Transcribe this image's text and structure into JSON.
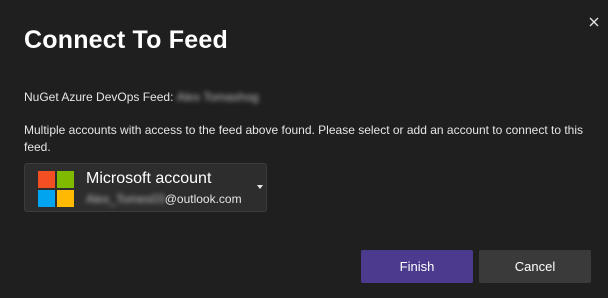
{
  "dialog": {
    "title": "Connect To Feed",
    "close_icon": "close-icon"
  },
  "feed": {
    "label": "NuGet Azure DevOps Feed:",
    "name_obscured": "Alex Tomashog"
  },
  "message": "Multiple accounts with access to the feed above found. Please select or add an account to connect to this feed.",
  "account": {
    "type": "Microsoft account",
    "email_obscured": "Alex_Tomes03",
    "email_domain": "@outlook.com",
    "logo_colors": [
      "#f25022",
      "#7fba00",
      "#00a4ef",
      "#ffb900"
    ],
    "dropdown_icon": "chevron-down-icon"
  },
  "buttons": {
    "finish": "Finish",
    "cancel": "Cancel"
  },
  "colors": {
    "background": "#1f1f1f",
    "primary_button": "#4c3a8e",
    "secondary_button": "#3a3a3a"
  }
}
